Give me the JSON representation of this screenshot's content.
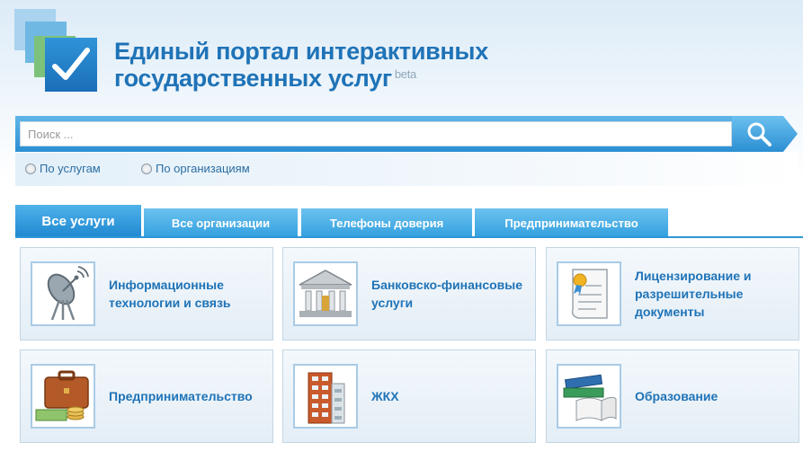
{
  "header": {
    "title_line1": "Единый портал интерактивных",
    "title_line2": "государственных услуг",
    "badge": "beta"
  },
  "search": {
    "placeholder": "Поиск ...",
    "value": "",
    "options": [
      {
        "label": "По услугам",
        "selected": false
      },
      {
        "label": "По организациям",
        "selected": false
      }
    ]
  },
  "tabs": [
    {
      "label": "Все услуги",
      "active": true
    },
    {
      "label": "Все организации",
      "active": false
    },
    {
      "label": "Телефоны доверия",
      "active": false
    },
    {
      "label": "Предпринимательство",
      "active": false
    }
  ],
  "categories": [
    {
      "label": "Информационные\nтехнологии и связь",
      "icon": "satellite-dish-icon"
    },
    {
      "label": "Банковско-финансовые\nуслуги",
      "icon": "bank-building-icon"
    },
    {
      "label": "Лицензирование и\nразрешительные\nдокументы",
      "icon": "certificate-document-icon"
    },
    {
      "label": "Предпринимательство",
      "icon": "briefcase-money-icon"
    },
    {
      "label": "ЖКХ",
      "icon": "apartment-building-icon"
    },
    {
      "label": "Образование",
      "icon": "books-icon"
    }
  ],
  "colors": {
    "brand_blue": "#1f73b7",
    "tab_blue": "#33a0df",
    "logo_green": "#7dc27a"
  }
}
